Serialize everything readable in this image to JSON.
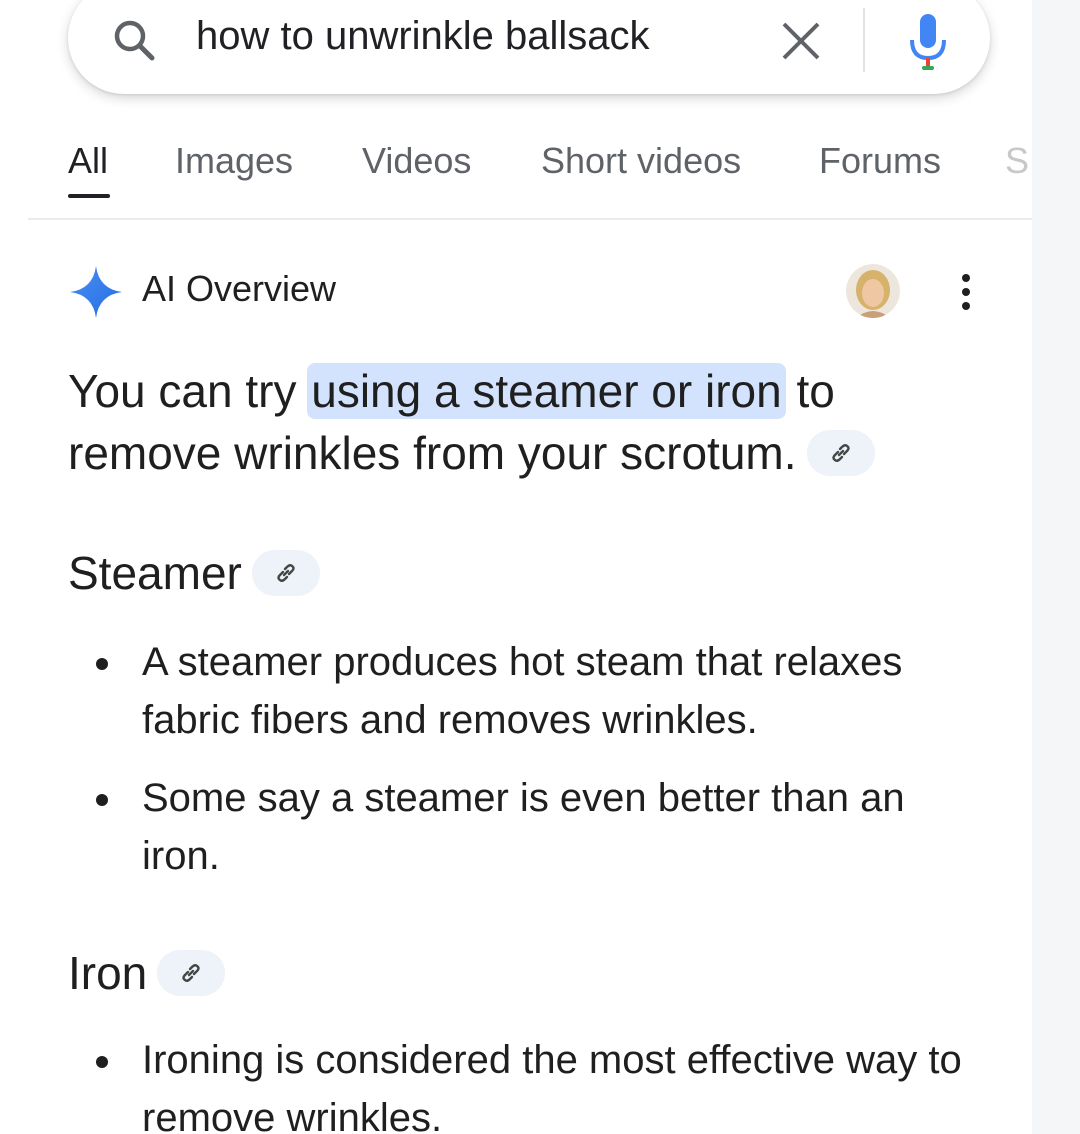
{
  "search": {
    "query": "how to unwrinkle ballsack"
  },
  "tabs": [
    {
      "label": "All",
      "active": true
    },
    {
      "label": "Images",
      "active": false
    },
    {
      "label": "Videos",
      "active": false
    },
    {
      "label": "Short videos",
      "active": false
    },
    {
      "label": "Forums",
      "active": false
    },
    {
      "label": "S",
      "active": false
    }
  ],
  "ai_overview": {
    "title": "AI Overview",
    "summary_before": "You can try ",
    "summary_highlight": "using a steamer or iron",
    "summary_after": " to remove wrinkles from your scrotum.",
    "sections": [
      {
        "heading": "Steamer",
        "bullets": [
          "A steamer produces hot steam that relaxes fabric fibers and removes wrinkles.",
          "Some say a steamer is even better than an iron."
        ]
      },
      {
        "heading": "Iron",
        "bullets": [
          "Ironing is considered the most effective way to remove wrinkles."
        ]
      }
    ]
  },
  "icons": {
    "search": "search-icon",
    "clear": "close-icon",
    "mic": "microphone-icon",
    "spark": "sparkle-icon",
    "more": "more-vert-icon",
    "link": "link-icon"
  },
  "colors": {
    "highlight": "#d3e3fd",
    "link_chip": "#eef2f9",
    "spark_blue": "#4285f4",
    "mic_blue": "#4285f4",
    "mic_red": "#ea4335"
  }
}
